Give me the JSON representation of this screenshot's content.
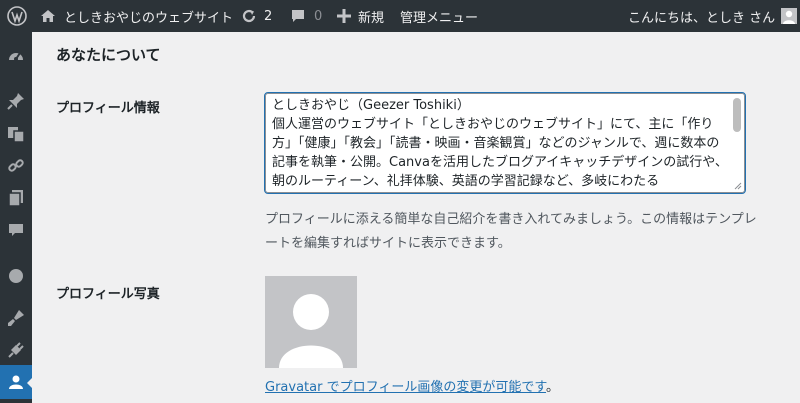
{
  "admin_bar": {
    "site_name": "としきおやじのウェブサイト",
    "updates_count": "2",
    "comments_count": "0",
    "new_label": "新規",
    "admin_menu_label": "管理メニュー",
    "greeting": "こんにちは、としき さん"
  },
  "sidebar": {
    "icons": [
      "dashboard-icon",
      "pin-icon",
      "media-icon",
      "link-icon",
      "pages-icon",
      "comments-icon",
      "circle-icon",
      "appearance-icon",
      "plugins-icon",
      "users-icon"
    ],
    "active": "users-icon"
  },
  "main": {
    "section_title": "あなたについて",
    "bio_label": "プロフィール情報",
    "bio_text": "としきおやじ（Geezer Toshiki）\n個人運営のウェブサイト「としきおやじのウェブサイト」にて、主に「作り方」「健康」「教会」「読書・映画・音楽観賞」などのジャンルで、週に数本の記事を執筆・公開。Canvaを活用したブログアイキャッチデザインの試行や、朝のルーティーン、礼拝体験、英語の学習記録など、多岐にわたる",
    "bio_description": "プロフィールに添える簡単な自己紹介を書き入れてみましょう。この情報はテンプレートを編集すればサイトに表示できます。",
    "photo_label": "プロフィール写真",
    "gravatar_link": "Gravatar でプロフィール画像の変更が可能です",
    "gravatar_suffix": "。"
  },
  "colors": {
    "admin_bar_bg": "#2c3338",
    "accent": "#2271b1",
    "page_bg": "#f0f0f1"
  }
}
